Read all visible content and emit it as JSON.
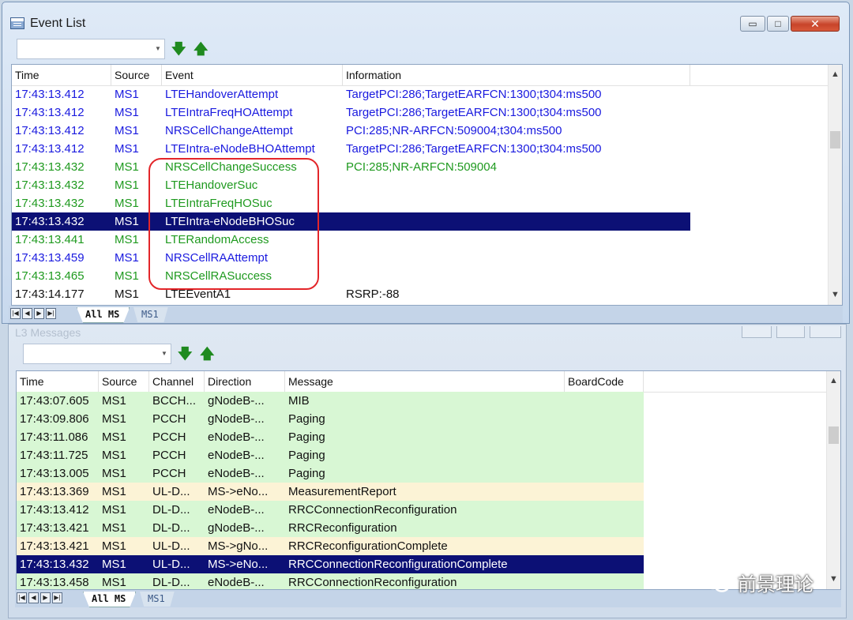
{
  "event_window": {
    "title": "Event List",
    "caption_buttons": {
      "minimize": "▭",
      "maximize": "□",
      "close": "✕"
    },
    "filter_value": "",
    "columns": [
      "Time",
      "Source",
      "Event",
      "Information"
    ],
    "rows": [
      {
        "time": "17:43:13.412",
        "source": "MS1",
        "event": "LTEHandoverAttempt",
        "info": "TargetPCI:286;TargetEARFCN:1300;t304:ms500",
        "color": "#1a1adf",
        "selected": false
      },
      {
        "time": "17:43:13.412",
        "source": "MS1",
        "event": "LTEIntraFreqHOAttempt",
        "info": "TargetPCI:286;TargetEARFCN:1300;t304:ms500",
        "color": "#1a1adf",
        "selected": false
      },
      {
        "time": "17:43:13.412",
        "source": "MS1",
        "event": "NRSCellChangeAttempt",
        "info": "PCI:285;NR-ARFCN:509004;t304:ms500",
        "color": "#1a1adf",
        "selected": false
      },
      {
        "time": "17:43:13.412",
        "source": "MS1",
        "event": "LTEIntra-eNodeBHOAttempt",
        "info": "TargetPCI:286;TargetEARFCN:1300;t304:ms500",
        "color": "#1a1adf",
        "selected": false
      },
      {
        "time": "17:43:13.432",
        "source": "MS1",
        "event": "NRSCellChangeSuccess",
        "info": "PCI:285;NR-ARFCN:509004",
        "color": "#1f9a1f",
        "selected": false
      },
      {
        "time": "17:43:13.432",
        "source": "MS1",
        "event": "LTEHandoverSuc",
        "info": "",
        "color": "#1f9a1f",
        "selected": false
      },
      {
        "time": "17:43:13.432",
        "source": "MS1",
        "event": "LTEIntraFreqHOSuc",
        "info": "",
        "color": "#1f9a1f",
        "selected": false
      },
      {
        "time": "17:43:13.432",
        "source": "MS1",
        "event": "LTEIntra-eNodeBHOSuc",
        "info": "",
        "color": "#ffffff",
        "selected": true
      },
      {
        "time": "17:43:13.441",
        "source": "MS1",
        "event": "LTERandomAccess",
        "info": "",
        "color": "#1f9a1f",
        "selected": false
      },
      {
        "time": "17:43:13.459",
        "source": "MS1",
        "event": "NRSCellRAAttempt",
        "info": "",
        "color": "#1a1adf",
        "selected": false
      },
      {
        "time": "17:43:13.465",
        "source": "MS1",
        "event": "NRSCellRASuccess",
        "info": "",
        "color": "#1f9a1f",
        "selected": false
      },
      {
        "time": "17:43:14.177",
        "source": "MS1",
        "event": "LTEEventA1",
        "info": "RSRP:-88",
        "color": "#111111",
        "selected": false
      }
    ],
    "tabs": [
      "All MS",
      "MS1"
    ],
    "active_tab": "All MS"
  },
  "message_window": {
    "title": "L3 Messages",
    "filter_value": "",
    "columns": [
      "Time",
      "Source",
      "Channel",
      "Direction",
      "Message",
      "BoardCode"
    ],
    "rows": [
      {
        "time": "17:43:07.605",
        "source": "MS1",
        "channel": "BCCH...",
        "direction": "gNodeB-...",
        "message": "MIB",
        "style": "green"
      },
      {
        "time": "17:43:09.806",
        "source": "MS1",
        "channel": "PCCH",
        "direction": "gNodeB-...",
        "message": "Paging",
        "style": "green"
      },
      {
        "time": "17:43:11.086",
        "source": "MS1",
        "channel": "PCCH",
        "direction": "eNodeB-...",
        "message": "Paging",
        "style": "green"
      },
      {
        "time": "17:43:11.725",
        "source": "MS1",
        "channel": "PCCH",
        "direction": "eNodeB-...",
        "message": "Paging",
        "style": "green"
      },
      {
        "time": "17:43:13.005",
        "source": "MS1",
        "channel": "PCCH",
        "direction": "eNodeB-...",
        "message": "Paging",
        "style": "green"
      },
      {
        "time": "17:43:13.369",
        "source": "MS1",
        "channel": "UL-D...",
        "direction": "MS->eNo...",
        "message": "MeasurementReport",
        "style": "cream"
      },
      {
        "time": "17:43:13.412",
        "source": "MS1",
        "channel": "DL-D...",
        "direction": "eNodeB-...",
        "message": "RRCConnectionReconfiguration",
        "style": "green"
      },
      {
        "time": "17:43:13.421",
        "source": "MS1",
        "channel": "DL-D...",
        "direction": "gNodeB-...",
        "message": "RRCReconfiguration",
        "style": "green"
      },
      {
        "time": "17:43:13.421",
        "source": "MS1",
        "channel": "UL-D...",
        "direction": "MS->gNo...",
        "message": "RRCReconfigurationComplete",
        "style": "cream"
      },
      {
        "time": "17:43:13.432",
        "source": "MS1",
        "channel": "UL-D...",
        "direction": "MS->eNo...",
        "message": "RRCConnectionReconfigurationComplete",
        "style": "sel"
      },
      {
        "time": "17:43:13.458",
        "source": "MS1",
        "channel": "DL-D...",
        "direction": "eNodeB-...",
        "message": "RRCConnectionReconfiguration",
        "style": "green"
      }
    ],
    "tabs": [
      "All MS",
      "MS1"
    ],
    "active_tab": "All MS"
  },
  "toolbar_icons": [
    "arrow-down-green-icon",
    "arrow-up-green-icon"
  ],
  "watermark": "前景理论"
}
